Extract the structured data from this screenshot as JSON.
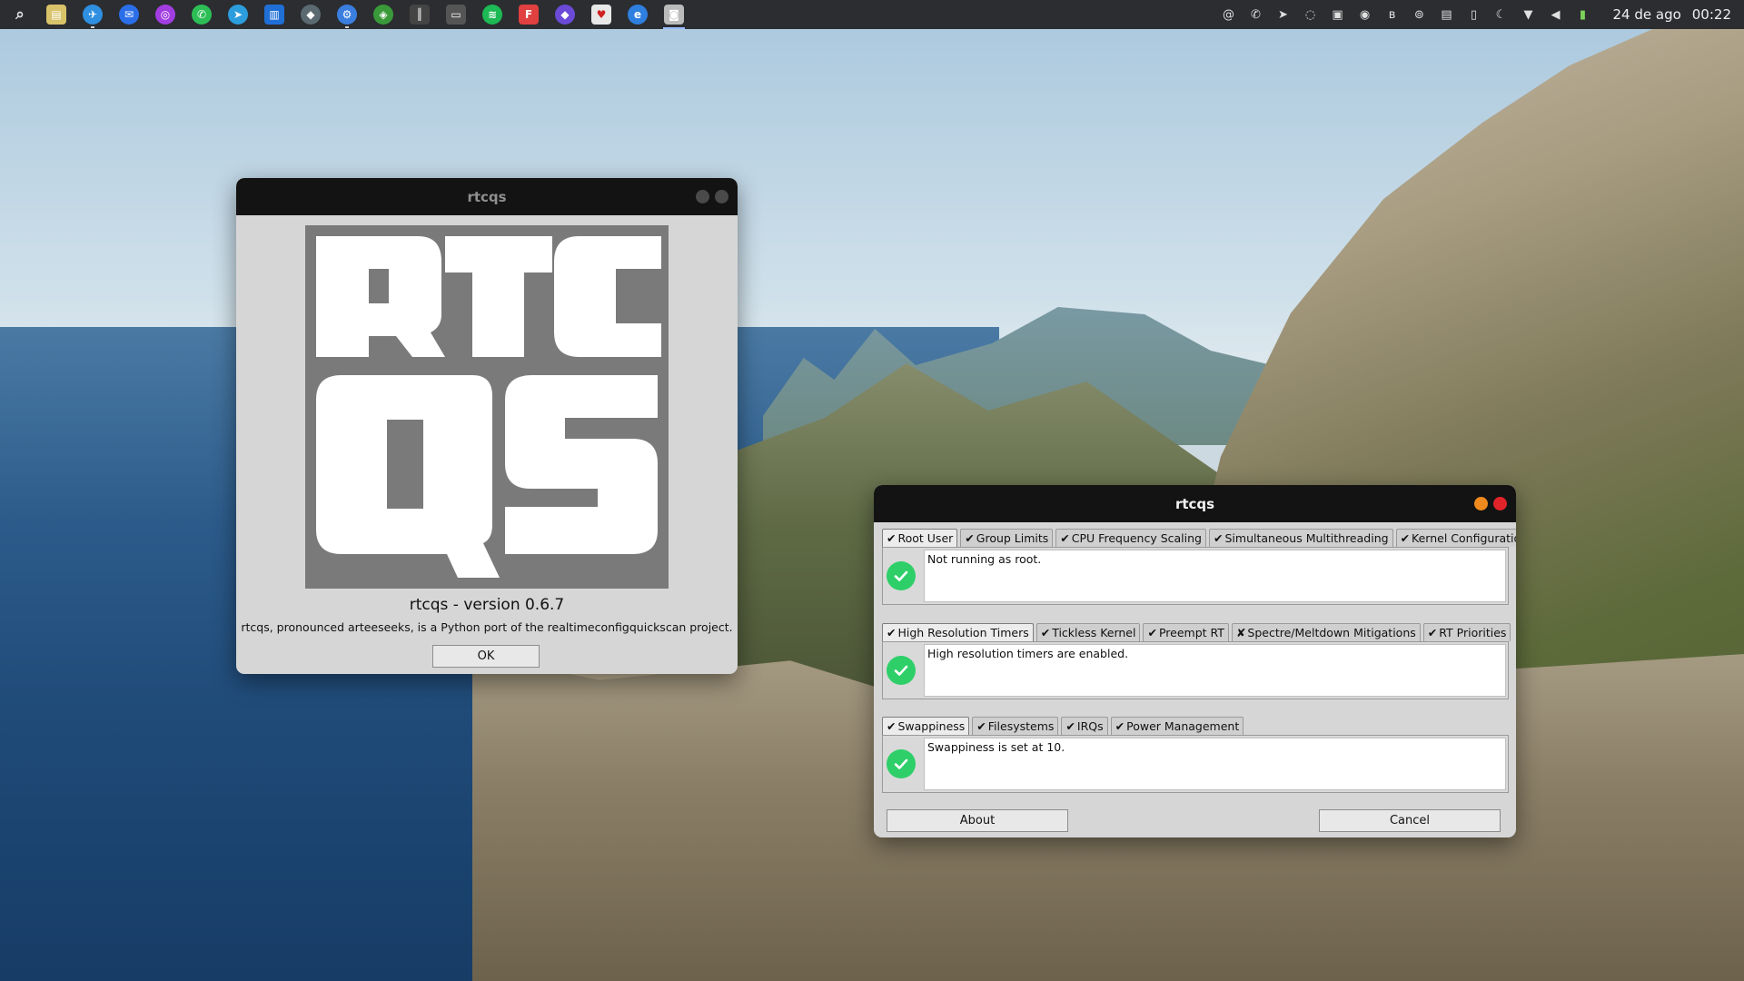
{
  "panel": {
    "launchers": [
      {
        "name": "search",
        "glyph": "⌕",
        "color": "#2b2d31",
        "shape": "sq"
      },
      {
        "name": "files",
        "glyph": "▤",
        "color": "#d8c26a",
        "shape": "sq"
      },
      {
        "name": "browser",
        "glyph": "✈",
        "color": "#2f8fe0",
        "shape": "round"
      },
      {
        "name": "thunderbird",
        "glyph": "✉",
        "color": "#2a6ee8",
        "shape": "round"
      },
      {
        "name": "podcast",
        "glyph": "◎",
        "color": "#a23ee0",
        "shape": "round"
      },
      {
        "name": "whatsapp",
        "glyph": "✆",
        "color": "#2dbf56",
        "shape": "round"
      },
      {
        "name": "telegram",
        "glyph": "➤",
        "color": "#2c9ddd",
        "shape": "round"
      },
      {
        "name": "trello",
        "glyph": "▥",
        "color": "#1f6fd6",
        "shape": "sq"
      },
      {
        "name": "inkscape",
        "glyph": "◆",
        "color": "#5a6a70",
        "shape": "round"
      },
      {
        "name": "steam",
        "glyph": "⚙",
        "color": "#3a7fe0",
        "shape": "round"
      },
      {
        "name": "brave",
        "glyph": "◈",
        "color": "#3a9a3a",
        "shape": "round"
      },
      {
        "name": "ardour",
        "glyph": "║",
        "color": "#444444",
        "shape": "sq"
      },
      {
        "name": "gamepad",
        "glyph": "▭",
        "color": "#555555",
        "shape": "sq"
      },
      {
        "name": "spotify",
        "glyph": "≋",
        "color": "#1db954",
        "shape": "round"
      },
      {
        "name": "flathub",
        "glyph": "F",
        "color": "#e04040",
        "shape": "sq"
      },
      {
        "name": "devtools",
        "glyph": "◆",
        "color": "#6a4ad6",
        "shape": "round"
      },
      {
        "name": "cards",
        "glyph": "♥",
        "color": "#e8e8e8",
        "shape": "sq"
      },
      {
        "name": "edge",
        "glyph": "e",
        "color": "#2f7fe0",
        "shape": "round"
      },
      {
        "name": "rtcqs",
        "glyph": "◙",
        "color": "#bbbbbb",
        "shape": "sq"
      }
    ],
    "tray": [
      {
        "name": "at-icon",
        "glyph": "@"
      },
      {
        "name": "whatsapp-icon",
        "glyph": "✆"
      },
      {
        "name": "telegram-icon",
        "glyph": "➤"
      },
      {
        "name": "sync-icon",
        "glyph": "◌"
      },
      {
        "name": "drive-icon",
        "glyph": "▣"
      },
      {
        "name": "mail-icon",
        "glyph": "◉"
      },
      {
        "name": "bluetooth-icon",
        "glyph": "ʙ"
      },
      {
        "name": "vpn-icon",
        "glyph": "⊚"
      },
      {
        "name": "notes-icon",
        "glyph": "▤"
      },
      {
        "name": "phone-icon",
        "glyph": "▯"
      },
      {
        "name": "night-light-icon",
        "glyph": "☾"
      },
      {
        "name": "wifi-icon",
        "glyph": "▼"
      },
      {
        "name": "volume-icon",
        "glyph": "◀"
      },
      {
        "name": "battery-icon",
        "glyph": "▮"
      }
    ],
    "date": "24 de ago",
    "time": "00:22"
  },
  "about_window": {
    "title": "rtcqs",
    "version_text": "rtcqs - version 0.6.7",
    "description": "rtcqs, pronounced arteeseeks, is a Python port of the realtimeconfigquickscan project.",
    "ok_label": "OK",
    "logo_text": "RTCQS",
    "button_colors": [
      "#4a4a4a",
      "#4a4a4a"
    ]
  },
  "checks_window": {
    "title": "rtcqs",
    "button_colors": [
      "#f08a1e",
      "#e0242a"
    ],
    "groups": [
      {
        "tabs": [
          {
            "mark": "✔",
            "label": "Root User",
            "selected": true
          },
          {
            "mark": "✔",
            "label": "Group Limits",
            "selected": false
          },
          {
            "mark": "✔",
            "label": "CPU Frequency Scaling",
            "selected": false
          },
          {
            "mark": "✔",
            "label": "Simultaneous Multithreading",
            "selected": false
          },
          {
            "mark": "✔",
            "label": "Kernel Configuration",
            "selected": false
          }
        ],
        "message": "Not running as root.",
        "status": "ok"
      },
      {
        "tabs": [
          {
            "mark": "✔",
            "label": "High Resolution Timers",
            "selected": true
          },
          {
            "mark": "✔",
            "label": "Tickless Kernel",
            "selected": false
          },
          {
            "mark": "✔",
            "label": "Preempt RT",
            "selected": false
          },
          {
            "mark": "✘",
            "label": "Spectre/Meltdown Mitigations",
            "selected": false
          },
          {
            "mark": "✔",
            "label": "RT Priorities",
            "selected": false
          }
        ],
        "message": "High resolution timers are enabled.",
        "status": "ok"
      },
      {
        "tabs": [
          {
            "mark": "✔",
            "label": "Swappiness",
            "selected": true
          },
          {
            "mark": "✔",
            "label": "Filesystems",
            "selected": false
          },
          {
            "mark": "✔",
            "label": "IRQs",
            "selected": false
          },
          {
            "mark": "✔",
            "label": "Power Management",
            "selected": false
          }
        ],
        "message": "Swappiness is set at 10.",
        "status": "ok"
      }
    ],
    "about_label": "About",
    "cancel_label": "Cancel"
  }
}
